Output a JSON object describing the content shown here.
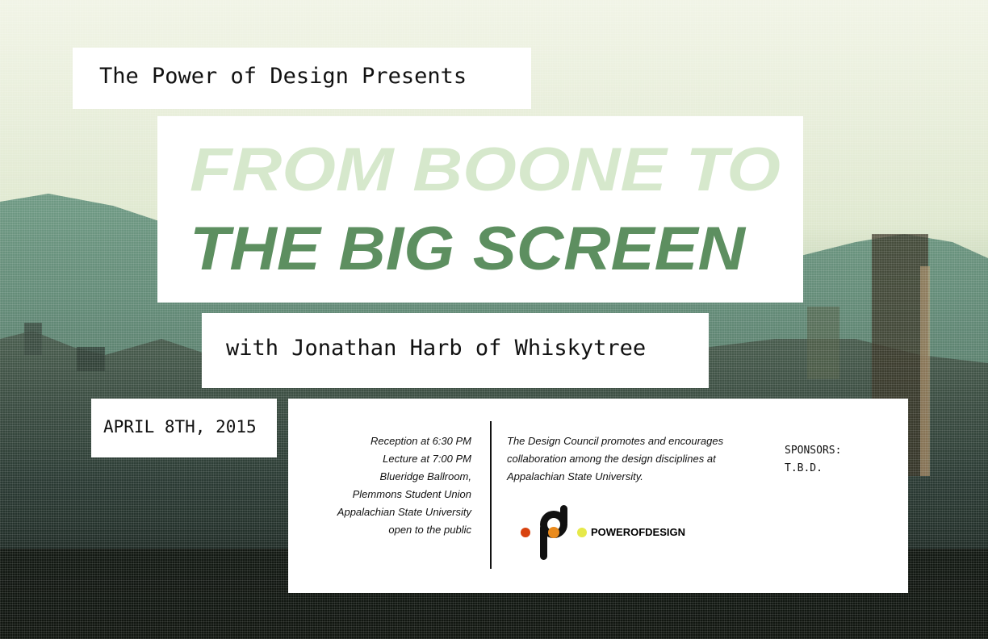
{
  "header": {
    "presents": "The Power of Design Presents"
  },
  "title": {
    "line1": "FROM BOONE TO",
    "line2": "THE BIG SCREEN"
  },
  "speaker": "with Jonathan Harb of Whiskytree",
  "date": "APRIL 8TH, 2015",
  "details": [
    "Reception at 6:30 PM",
    "Lecture at 7:00 PM",
    "Blueridge Ballroom,",
    "Plemmons Student Union",
    "Appalachian State University",
    "open to the public"
  ],
  "about": "The Design Council promotes and encourages collaboration among the design disciplines at Appalachian State University.",
  "sponsors": {
    "label": "SPONSORS:",
    "value": "T.B.D."
  },
  "logo": {
    "text": "POWEROFDESIGN",
    "colors": [
      "#d8420f",
      "#e98a1c",
      "#e6e94a",
      "#111111"
    ]
  },
  "colors": {
    "title_top": "#d6e8cc",
    "title_bottom": "#5d8f60",
    "background": "#8aa98c"
  }
}
